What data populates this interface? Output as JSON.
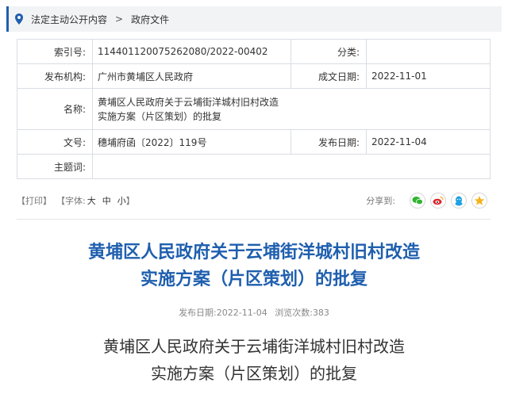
{
  "breadcrumb": {
    "items": [
      "法定主动公开内容",
      "政府文件"
    ],
    "separator": ">"
  },
  "meta": {
    "index_label": "索引号:",
    "index_value": "114401120075262080/2022-00402",
    "category_label": "分类:",
    "category_value": "",
    "issuer_label": "发布机构:",
    "issuer_value": "广州市黄埔区人民政府",
    "written_date_label": "成文日期:",
    "written_date_value": "2022-11-01",
    "name_label": "名称:",
    "name_line1": "黄埔区人民政府关于云埔街洋城村旧村改造",
    "name_line2": "实施方案（片区策划）的批复",
    "doc_no_label": "文号:",
    "doc_no_value": "穗埔府函〔2022〕119号",
    "publish_date_label": "发布日期:",
    "publish_date_value": "2022-11-04",
    "keywords_label": "主题词:",
    "keywords_value": ""
  },
  "toolbar": {
    "print": "【打印】",
    "font_label": "【字体:",
    "size_large": "大",
    "size_medium": "中",
    "size_small": "小",
    "close_bracket": "】",
    "share_label": "分享到:"
  },
  "share_icons": [
    "wechat-icon",
    "weibo-icon",
    "qq-icon",
    "qzone-icon"
  ],
  "article": {
    "title_line1": "黄埔区人民政府关于云埔街洋城村旧村改造",
    "title_line2": "实施方案（片区策划）的批复",
    "pub_date_label": "发布日期:",
    "pub_date": "2022-11-04",
    "views_label": "浏览次数:",
    "views": "383",
    "subtitle_line1": "黄埔区人民政府关于云埔街洋城村旧村改造",
    "subtitle_line2": "实施方案（片区策划）的批复"
  },
  "colors": {
    "accent": "#1f5fae",
    "wechat": "#2fb52f",
    "weibo": "#e5232b",
    "qq": "#1ea1e4",
    "qzone": "#f5b21a"
  }
}
